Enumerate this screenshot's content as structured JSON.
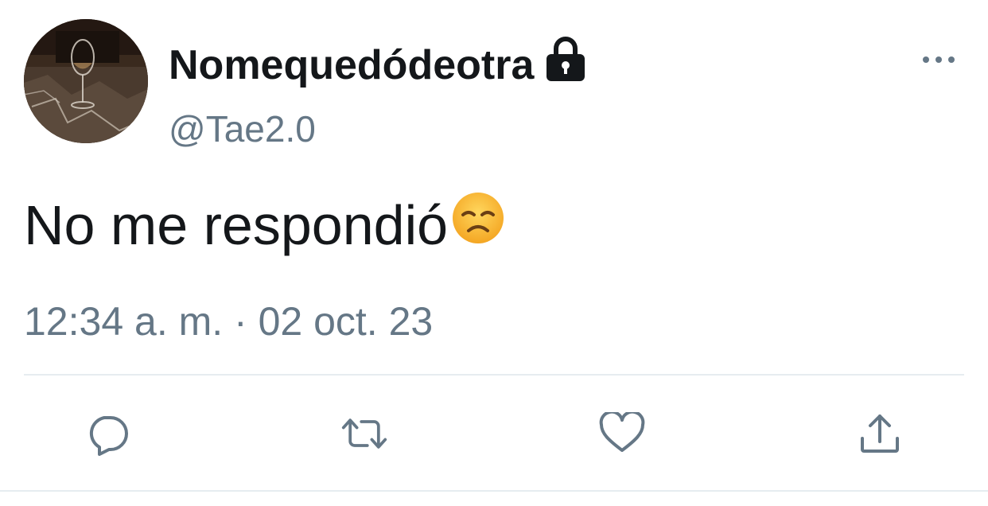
{
  "author": {
    "display_name": "Nomequedódeotra",
    "handle": "@Tae2.0",
    "protected_icon": "lock-icon",
    "avatar": "wine-glass-photo"
  },
  "tweet": {
    "text": "No me respondió",
    "emoji": "disappointed-face-emoji",
    "timestamp": "12:34 a. m. · 02 oct. 23"
  },
  "actions": [
    {
      "name": "reply",
      "icon": "reply-icon"
    },
    {
      "name": "retweet",
      "icon": "retweet-icon"
    },
    {
      "name": "like",
      "icon": "heart-icon"
    },
    {
      "name": "share",
      "icon": "share-icon"
    }
  ],
  "colors": {
    "text_primary": "#14171a",
    "text_secondary": "#657786",
    "divider": "#e6ecf0",
    "icon": "#657786",
    "emoji": "#f5b833"
  }
}
